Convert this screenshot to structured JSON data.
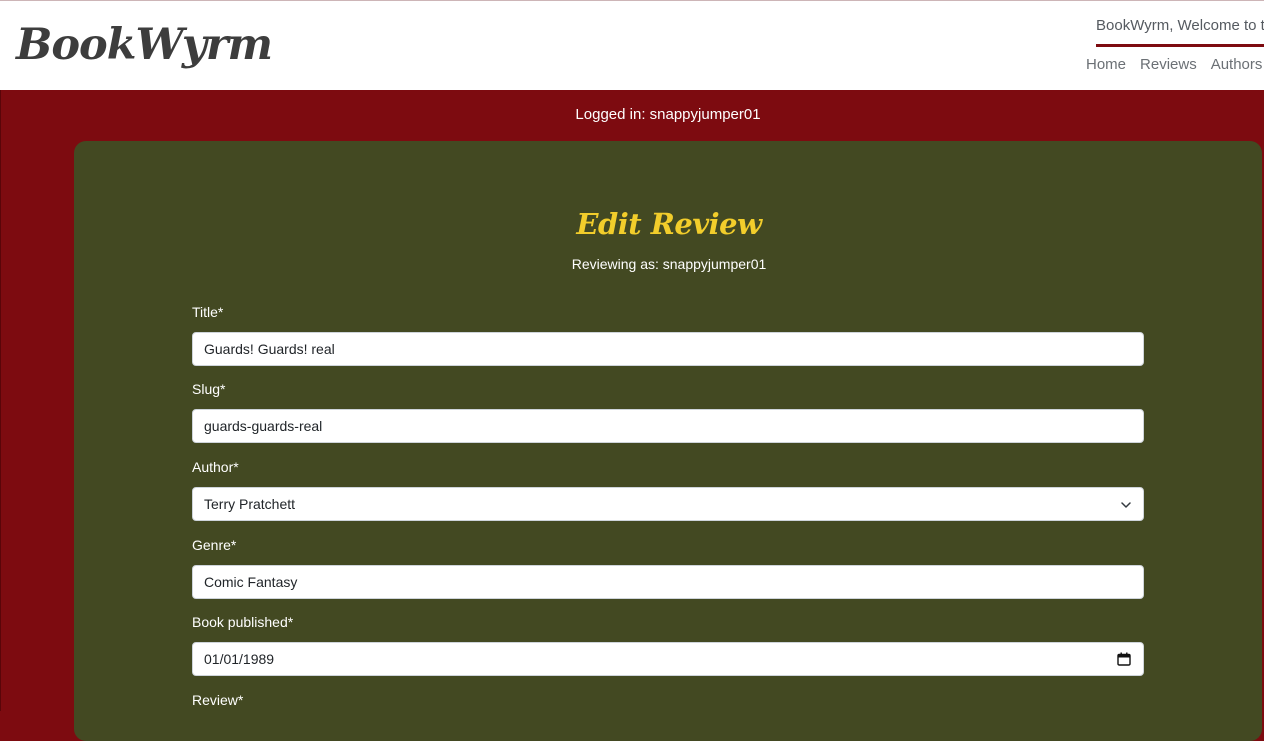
{
  "header": {
    "brand": "BookWyrm",
    "welcome": "BookWyrm, Welcome to th",
    "nav": [
      "Home",
      "Reviews",
      "Authors"
    ]
  },
  "status": {
    "logged_in": "Logged in: snappyjumper01"
  },
  "form": {
    "title": "Edit Review",
    "subtitle": "Reviewing as: snappyjumper01",
    "fields": {
      "title": {
        "label": "Title*",
        "value": "Guards! Guards! real"
      },
      "slug": {
        "label": "Slug*",
        "value": "guards-guards-real"
      },
      "author": {
        "label": "Author*",
        "value": "Terry Pratchett"
      },
      "genre": {
        "label": "Genre*",
        "value": "Comic Fantasy"
      },
      "published": {
        "label": "Book published*",
        "value": "01/01/1989"
      },
      "review": {
        "label": "Review*"
      }
    }
  },
  "colors": {
    "page_bg": "#7d0b10",
    "card_bg": "#434922",
    "title_accent": "#f2cd2b",
    "brand_text": "#3d3d3d"
  },
  "icons": {
    "author_select": "chevron-down-icon",
    "published_date": "calendar-icon"
  }
}
